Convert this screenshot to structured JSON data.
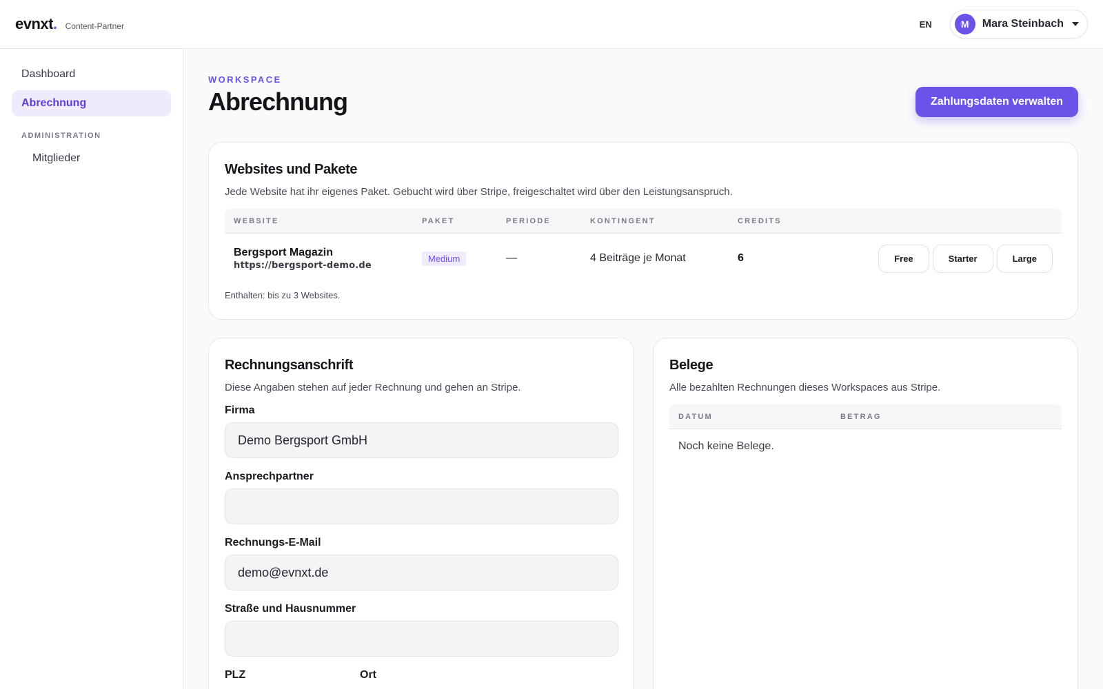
{
  "brand": {
    "name": "evnxt",
    "dot": ".",
    "subtitle": "Content-Partner"
  },
  "header": {
    "language": "EN",
    "user": {
      "initial": "M",
      "name": "Mara Steinbach"
    }
  },
  "sidebar": {
    "items": [
      {
        "label": "Dashboard",
        "active": false
      },
      {
        "label": "Abrechnung",
        "active": true
      }
    ],
    "section_label": "ADMINISTRATION",
    "sub_items": [
      {
        "label": "Mitglieder"
      }
    ]
  },
  "page": {
    "eyebrow": "WORKSPACE",
    "title": "Abrechnung",
    "primary_button": "Zahlungsdaten verwalten"
  },
  "websites": {
    "title": "Websites und Pakete",
    "description": "Jede Website hat ihr eigenes Paket. Gebucht wird über Stripe, freigeschaltet wird über den Leistungsanspruch.",
    "columns": [
      "WEBSITE",
      "PAKET",
      "PERIODE",
      "KONTINGENT",
      "CREDITS"
    ],
    "rows": [
      {
        "name": "Bergsport Magazin",
        "url": "https://bergsport-demo.de",
        "paket": "Medium",
        "periode": "—",
        "kontingent": "4 Beiträge je Monat",
        "credits": "6",
        "plan_options": [
          "Free",
          "Starter",
          "Large"
        ]
      }
    ],
    "footnote": "Enthalten: bis zu 3 Websites."
  },
  "address": {
    "title": "Rechnungsanschrift",
    "description": "Diese Angaben stehen auf jeder Rechnung und gehen an Stripe.",
    "fields": {
      "firma": {
        "label": "Firma",
        "value": "Demo Bergsport GmbH"
      },
      "ansprechpartner": {
        "label": "Ansprechpartner",
        "value": ""
      },
      "email": {
        "label": "Rechnungs-E-Mail",
        "value": "demo@evnxt.de"
      },
      "strasse": {
        "label": "Straße und Hausnummer",
        "value": ""
      },
      "plz": {
        "label": "PLZ"
      },
      "ort": {
        "label": "Ort"
      }
    }
  },
  "receipts": {
    "title": "Belege",
    "description": "Alle bezahlten Rechnungen dieses Workspaces aus Stripe.",
    "columns": [
      "DATUM",
      "BETRAG"
    ],
    "empty_text": "Noch keine Belege."
  },
  "colors": {
    "accent": "#6b52e8",
    "accent_soft": "#efebfd"
  }
}
